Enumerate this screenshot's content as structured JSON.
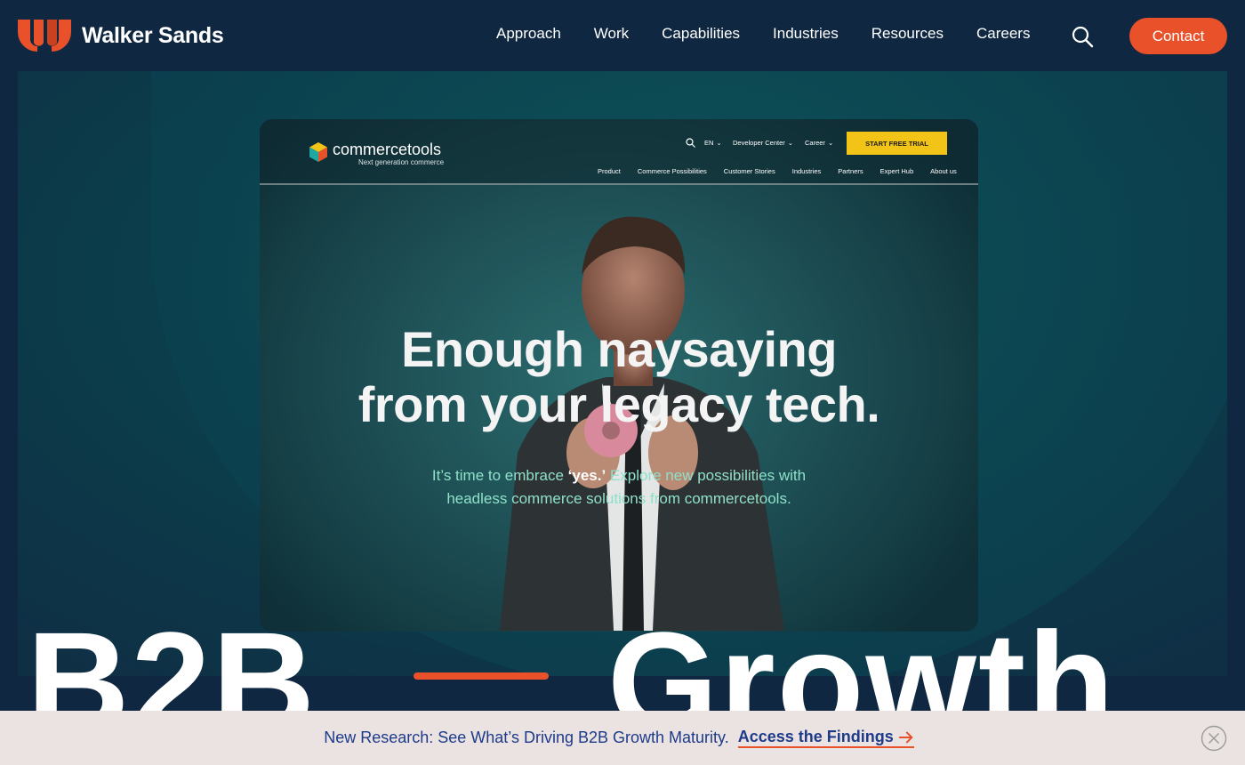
{
  "header": {
    "logo_text": "Walker Sands",
    "nav": [
      "Approach",
      "Work",
      "Capabilities",
      "Industries",
      "Resources",
      "Careers"
    ],
    "contact_label": "Contact"
  },
  "hero": {
    "screenshot": {
      "brand": "commercetools",
      "tagline": "Next generation commerce",
      "lang": "EN",
      "util_links": [
        "Developer Center",
        "Career"
      ],
      "cta": "START FREE TRIAL",
      "menu": [
        "Product",
        "Commerce Possibilities",
        "Customer Stories",
        "Industries",
        "Partners",
        "Expert Hub",
        "About us"
      ],
      "headline_line1": "Enough naysaying",
      "headline_line2": "from your legacy tech.",
      "sub_pre": "It’s time to embrace ",
      "sub_bold": "‘yes.’",
      "sub_post": " Explore new possibilities with",
      "sub_line2": "headless commerce solutions from commercetools."
    },
    "big_left": "B2B",
    "big_right": "Growth"
  },
  "announcement": {
    "text": "New Research: See What’s Driving B2B Growth Maturity.",
    "link": "Access the Findings"
  },
  "colors": {
    "accent": "#e8512a",
    "navy": "#0f2740",
    "teal": "#0b3d4a",
    "announce_bg": "#ebe3e2",
    "link_blue": "#1d3b8a"
  }
}
